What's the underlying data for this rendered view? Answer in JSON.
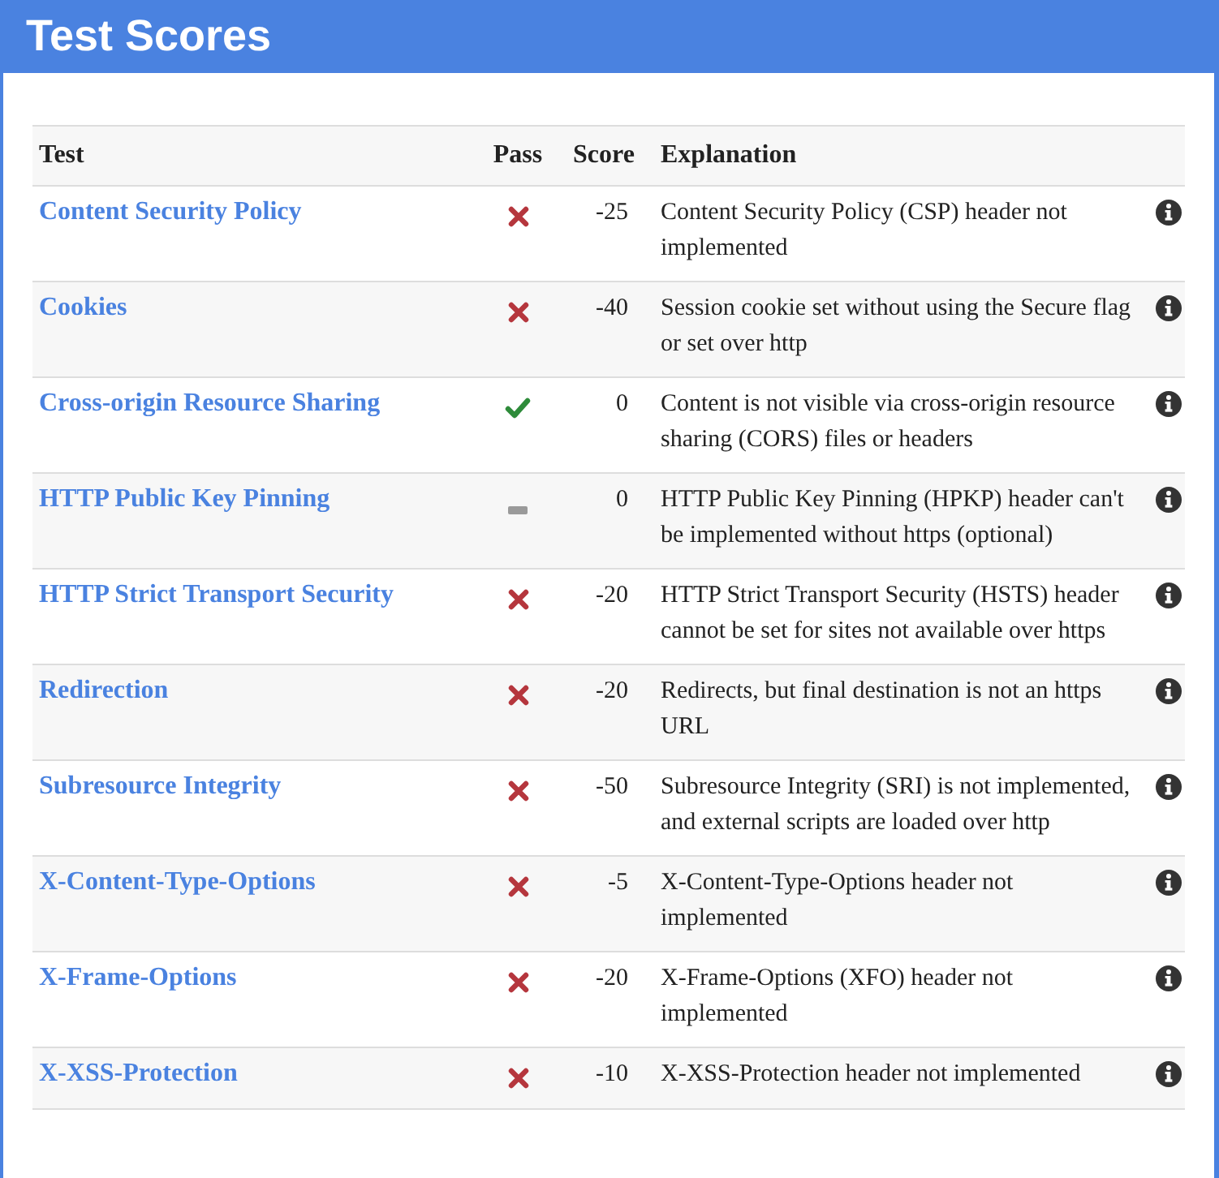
{
  "title": "Test Scores",
  "table": {
    "columns": [
      "Test",
      "Pass",
      "Score",
      "Explanation"
    ],
    "rows": [
      {
        "test": "Content Security Policy",
        "kind": "fail",
        "score": "-25",
        "explanation": "Content Security Policy (CSP) header not implemented"
      },
      {
        "test": "Cookies",
        "kind": "fail",
        "score": "-40",
        "explanation": "Session cookie set without using the Secure flag or set over http"
      },
      {
        "test": "Cross-origin Resource Sharing",
        "kind": "pass",
        "score": "0",
        "explanation": "Content is not visible via cross-origin resource sharing (CORS) files or headers"
      },
      {
        "test": "HTTP Public Key Pinning",
        "kind": "neutral",
        "score": "0",
        "explanation": "HTTP Public Key Pinning (HPKP) header can't be implemented without https (optional)"
      },
      {
        "test": "HTTP Strict Transport Security",
        "kind": "fail",
        "score": "-20",
        "explanation": "HTTP Strict Transport Security (HSTS) header cannot be set for sites not available over https"
      },
      {
        "test": "Redirection",
        "kind": "fail",
        "score": "-20",
        "explanation": "Redirects, but final destination is not an https URL"
      },
      {
        "test": "Subresource Integrity",
        "kind": "fail",
        "score": "-50",
        "explanation": "Subresource Integrity (SRI) is not implemented, and external scripts are loaded over http"
      },
      {
        "test": "X-Content-Type-Options",
        "kind": "fail",
        "score": "-5",
        "explanation": "X-Content-Type-Options header not implemented"
      },
      {
        "test": "X-Frame-Options",
        "kind": "fail",
        "score": "-20",
        "explanation": "X-Frame-Options (XFO) header not implemented"
      },
      {
        "test": "X-XSS-Protection",
        "kind": "fail",
        "score": "-10",
        "explanation": "X-XSS-Protection header not implemented"
      }
    ]
  }
}
